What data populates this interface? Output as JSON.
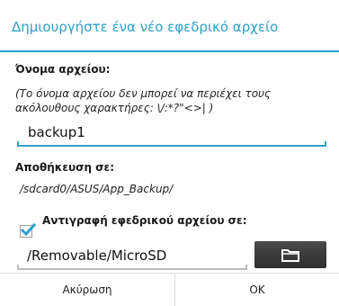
{
  "dialog": {
    "title": "Δημιουργήστε ένα νέο εφεδρικό αρχείο",
    "filename_label": "Όνομα αρχείου:",
    "filename_hint": "(Το όνομα αρχείου δεν μπορεί να περιέχει τους ακόλουθους χαρακτήρες: \\/:*?\"<>| )",
    "filename_value": "backup1",
    "save_location_label": "Αποθήκευση σε:",
    "save_location_path": "/sdcard0/ASUS/App_Backup/",
    "copy_checkbox_label": "Αντιγραφή εφεδρικού αρχείου σε:",
    "copy_checkbox_checked": true,
    "copy_path_value": "/Removable/MicroSD",
    "browse_icon": "folder-icon",
    "cancel_label": "Ακύρωση",
    "ok_label": "OK"
  },
  "colors": {
    "accent": "#34a0c8",
    "title": "#2d9fc6",
    "button_dark": "#3a3a3a"
  }
}
